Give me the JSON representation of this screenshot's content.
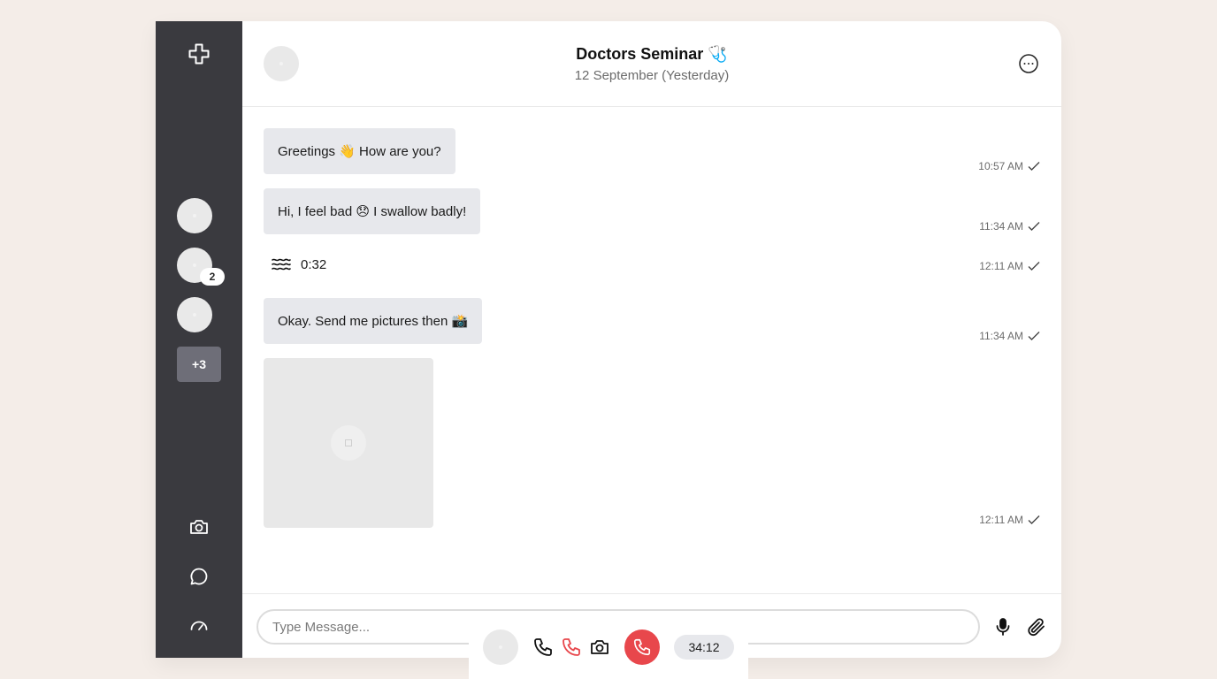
{
  "header": {
    "title": "Doctors Seminar 🩺",
    "subtitle": "12 September (Yesterday)"
  },
  "sidebar": {
    "unread_count": "2",
    "more_contacts": "+3",
    "icons": [
      "plus-logo-icon",
      "camera-icon",
      "chat-icon",
      "gauge-icon"
    ]
  },
  "messages": [
    {
      "type": "text",
      "text": "Greetings 👋 How are you?",
      "time": "10:57 AM",
      "status": "sent"
    },
    {
      "type": "text",
      "text": "Hi, I feel bad 😞 I swallow badly!",
      "time": "11:34 AM",
      "status": "sent"
    },
    {
      "type": "voice",
      "duration": "0:32",
      "time": "12:11 AM",
      "status": "sent"
    },
    {
      "type": "text",
      "text": "Okay. Send me pictures then 📸",
      "time": "11:34 AM",
      "status": "sent"
    },
    {
      "type": "image",
      "time": "12:11 AM",
      "status": "sent"
    }
  ],
  "composer": {
    "placeholder": "Type Message...",
    "icons": [
      "microphone-icon",
      "paperclip-icon"
    ]
  },
  "call": {
    "timer": "34:12",
    "hangup_color": "#e8474c",
    "icons": [
      "phone-icon",
      "phone-red-icon",
      "camera-icon",
      "hangup-icon"
    ]
  },
  "colors": {
    "background": "#f4ede8",
    "sidebar": "#3a3a3f",
    "bubble": "#e7e8ec",
    "accent_red": "#e8474c"
  }
}
